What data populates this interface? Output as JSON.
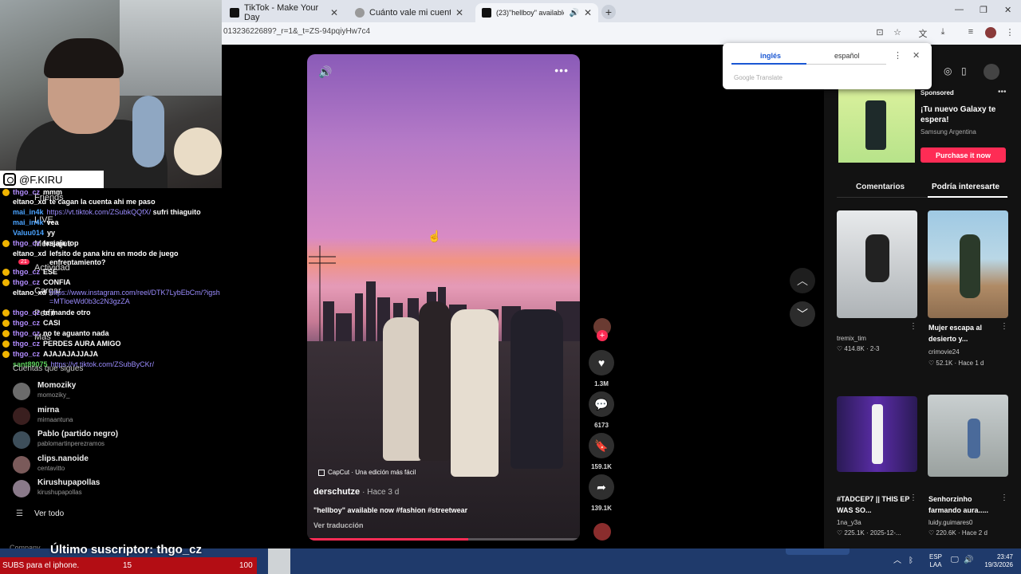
{
  "browser": {
    "tabs": [
      {
        "title": "TikTok - Make Your Day",
        "active": false
      },
      {
        "title": "Cuánto vale mi cuenta de Fortn",
        "active": false
      },
      {
        "title": "(23)\"hellboy\" available now",
        "active": true
      }
    ],
    "url": "01323622689?_r=1&_t=ZS-94pqiyHw7c4"
  },
  "translate_popup": {
    "lang_from": "inglés",
    "lang_to": "español",
    "brand": "Google Translate"
  },
  "webcam": {
    "handle": "@F.KIRU"
  },
  "tiktok_nav": {
    "items": [
      "Friends",
      "LIVE",
      "Mensajes",
      "Actividad",
      "Cargar",
      "Perfil",
      "Más"
    ],
    "activity_badge": "21",
    "messages_badge": "2",
    "following_title": "Cuentas que sigues",
    "following": [
      {
        "name": "Momoziky",
        "username": "momoziky_"
      },
      {
        "name": "mirna",
        "username": "mirnaantuna"
      },
      {
        "name": "Pablo (partido negro)",
        "username": "pablomartinperezramos"
      },
      {
        "name": "clips.nanoide",
        "username": "centavitto"
      },
      {
        "name": "Kirushupapollas",
        "username": "kirushupapollas"
      }
    ],
    "see_all": "Ver todo",
    "company": "Company"
  },
  "chat": {
    "messages": [
      {
        "user": "thgo_cz",
        "text": "mmm",
        "color": "#b28cff"
      },
      {
        "user": "eltano_xd",
        "text": "te cagan la cuenta ahi me paso",
        "color": "#ffffff"
      },
      {
        "user": "mai_in4k",
        "text": "sufri thiaguito",
        "link": "https://vt.tiktok.com/ZSubkQQfX/",
        "color": "#4aa3ff"
      },
      {
        "user": "mai_in4k",
        "text": "vea",
        "color": "#4aa3ff"
      },
      {
        "user": "Valuu014",
        "text": "yy",
        "color": "#4aa3ff"
      },
      {
        "user": "thgo_cz",
        "text": "fasjaja.top",
        "color": "#b28cff"
      },
      {
        "user": "eltano_xd",
        "text": "lefsito de pana kiru en modo de juego enfrentamiento?",
        "color": "#ffffff"
      },
      {
        "user": "thgo_cz",
        "text": "ESE",
        "color": "#b28cff"
      },
      {
        "user": "thgo_cz",
        "text": "CONFIA",
        "color": "#b28cff"
      },
      {
        "user": "eltano_xd",
        "text": "",
        "link": "https://www.instagram.com/reel/DTK7LybEbCm/?igsh=MTloeWd0b3c2N3gzZA",
        "color": "#ffffff"
      },
      {
        "user": "thgo_cz",
        "text": "te mande otro",
        "color": "#b28cff"
      },
      {
        "user": "thgo_cz",
        "text": "CASI",
        "color": "#b28cff"
      },
      {
        "user": "thgo_cz",
        "text": "no te aguanto nada",
        "color": "#b28cff"
      },
      {
        "user": "thgo_cz",
        "text": "PERDES AURA AMIGO",
        "color": "#b28cff"
      },
      {
        "user": "thgo_cz",
        "text": "AJAJAJAJJAJA",
        "color": "#b28cff"
      },
      {
        "user": "sant89075",
        "text": "",
        "link": "https://vt.tiktok.com/ZSubByCKr/",
        "color": "#5bd05b"
      }
    ]
  },
  "overlay": {
    "last_sub": "Último suscriptor: thgo_cz",
    "subs_goal_text": "SUBS para el iphone.",
    "subs_current": "15",
    "subs_target": "100"
  },
  "video": {
    "author": "derschutze",
    "time": "· Hace 3 d",
    "description": "\"hellboy\" available now #fashion #streetwear",
    "translate": "Ver traducción",
    "capcut": "CapCut · Una edición más fácil",
    "progress": 0.59,
    "likes": "1.3M",
    "comments": "6173",
    "saves": "159.1K",
    "shares": "139.1K"
  },
  "sidebar": {
    "ad": {
      "label": "Sponsored",
      "title": "¡Tu nuevo Galaxy te espera!",
      "advertiser": "Samsung Argentina",
      "cta": "Purchase it now"
    },
    "tabs": [
      "Comentarios",
      "Podría interesarte"
    ],
    "active_tab": 1,
    "cards": [
      {
        "title": "",
        "user": "tremix_tim",
        "likes": "414.8K",
        "date": "2-3"
      },
      {
        "title": "Mujer escapa al desierto y...",
        "user": "crimovie24",
        "likes": "52.1K",
        "date": "Hace 1 d"
      },
      {
        "title": "#TADCEP7 || THIS EP WAS SO...",
        "user": "1na_y3a",
        "likes": "225.1K",
        "date": "2025-12-..."
      },
      {
        "title": "Senhorzinho farmando aura.....",
        "user": "luidy.guimares0",
        "likes": "220.6K",
        "date": "Hace 2 d"
      }
    ]
  },
  "tray": {
    "lang": "ESP",
    "layout": "LAA",
    "time": "23:47",
    "date": "19/3/2026"
  },
  "colors": {
    "accent": "#fe2c55",
    "taskbar": "#1f3a6b",
    "subs_bar": "#b30d14"
  }
}
